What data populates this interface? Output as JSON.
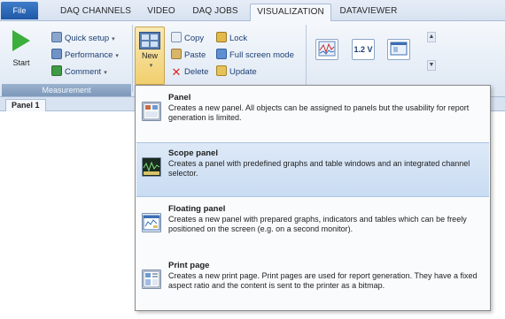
{
  "tabs": [
    "File",
    "DAQ CHANNELS",
    "VIDEO",
    "DAQ JOBS",
    "VISUALIZATION",
    "DATAVIEWER"
  ],
  "active_tab": "VISUALIZATION",
  "ribbon": {
    "start_label": "Start",
    "quick_setup_label": "Quick setup",
    "performance_label": "Performance",
    "comment_label": "Comment",
    "measurement_group_label": "Measurement",
    "new_label": "New",
    "copy_label": "Copy",
    "paste_label": "Paste",
    "delete_label": "Delete",
    "lock_label": "Lock",
    "fullscreen_label": "Full screen mode",
    "update_label": "Update",
    "gallery_value_label": "1.2 V"
  },
  "workspace": {
    "panel_tab_label": "Panel 1"
  },
  "dropdown": {
    "items": [
      {
        "title": "Panel",
        "description": "Creates a new panel. All objects can be assigned to panels but the usability for report generation is limited.",
        "icon": "panel-icon"
      },
      {
        "title": "Scope panel",
        "description": "Creates a panel with predefined graphs and table windows and an integrated channel selector.",
        "icon": "scope-panel-icon"
      },
      {
        "title": "Floating panel",
        "description": "Creates a new panel with prepared graphs, indicators and tables which can be freely positioned on the screen (e.g. on a second monitor).",
        "icon": "floating-panel-icon"
      },
      {
        "title": "Print page",
        "description": "Creates a new print page. Print pages are used for report generation. They have a fixed aspect ratio and the content is sent to the printer as a bitmap.",
        "icon": "print-page-icon"
      }
    ],
    "highlighted_index": 1
  },
  "colors": {
    "accent": "#1f58a6",
    "highlight": "#c9dcf2",
    "start_green": "#3cae3c",
    "delete_red": "#d9261c"
  }
}
